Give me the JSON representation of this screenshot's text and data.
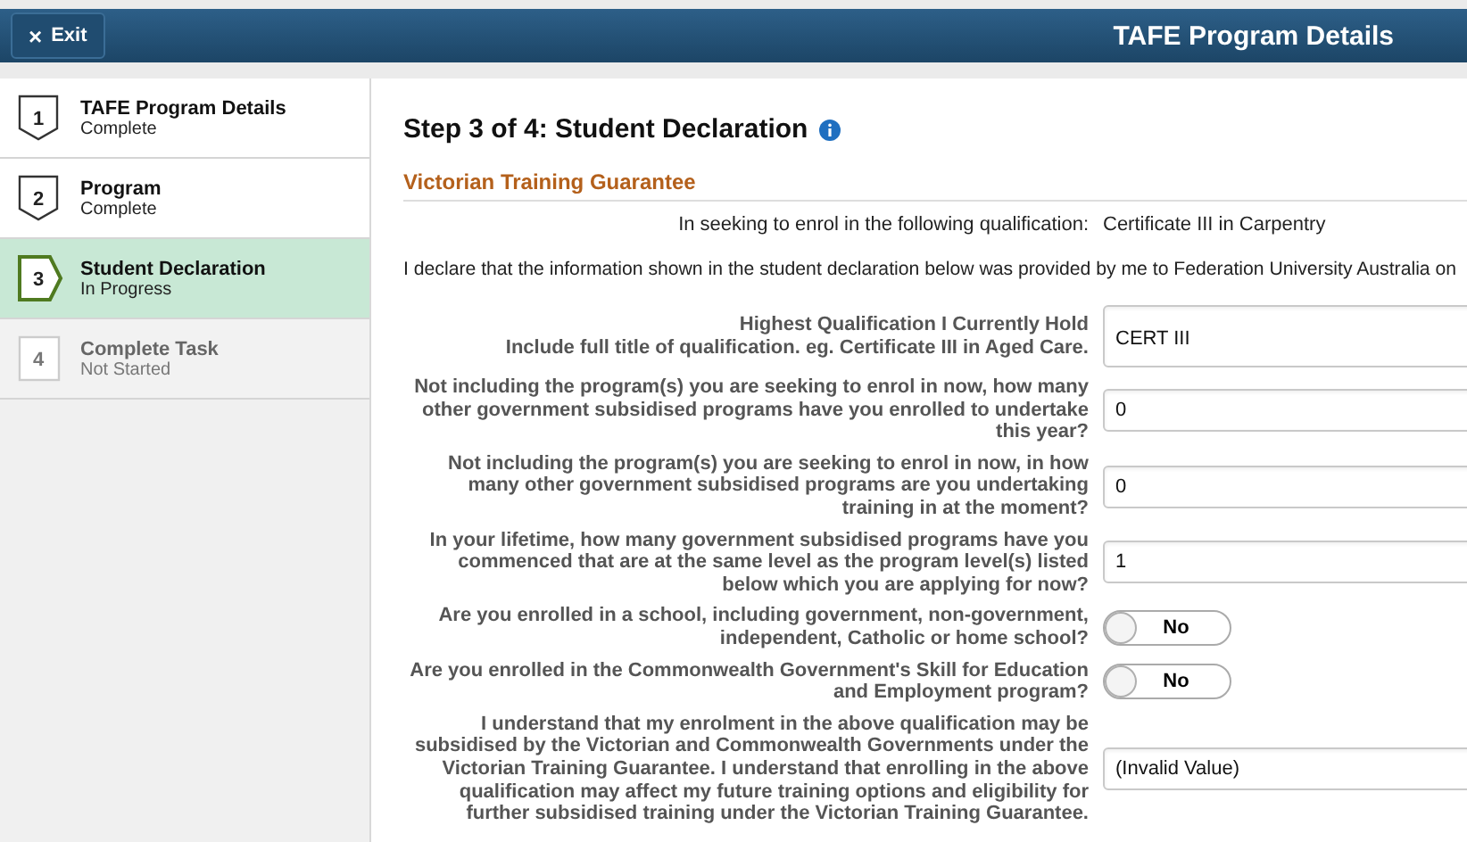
{
  "header": {
    "exit_label": "Exit",
    "exit_icon": "×",
    "title": "TAFE Program Details"
  },
  "steps": [
    {
      "number": "1",
      "name": "TAFE Program Details",
      "status": "Complete",
      "kind": "complete",
      "selected": false
    },
    {
      "number": "2",
      "name": "Program",
      "status": "Complete",
      "kind": "complete",
      "selected": false
    },
    {
      "number": "3",
      "name": "Student Declaration",
      "status": "In Progress",
      "kind": "current",
      "selected": true
    },
    {
      "number": "4",
      "name": "Complete Task",
      "status": "Not Started",
      "kind": "pending",
      "selected": false
    }
  ],
  "page": {
    "title": "Step 3 of 4: Student Declaration",
    "section": "Victorian Training Guarantee",
    "qualification_label": "In seeking to enrol in the following qualification:",
    "qualification_value": "Certificate III in Carpentry",
    "declaration": "I declare that the information shown in the student declaration below was provided by me to Federation University Australia on"
  },
  "questions": [
    {
      "kind": "text",
      "label": "Highest Qualification I Currently Hold",
      "hint": "Include full title of qualification. eg. Certificate III in Aged Care.",
      "value": "CERT III"
    },
    {
      "kind": "text",
      "label": "Not including the program(s) you are seeking to enrol in now, how many other government subsidised programs have you enrolled to undertake this year?",
      "value": "0"
    },
    {
      "kind": "text",
      "label": "Not including the program(s) you are seeking to enrol in now, in how many other government subsidised programs are you undertaking training in at the moment?",
      "value": "0"
    },
    {
      "kind": "text",
      "label": "In your lifetime, how many government subsidised programs have you commenced that are at the same level as the program level(s) listed below which you are applying for now?",
      "value": "1"
    },
    {
      "kind": "toggle",
      "label": "Are you enrolled in a school, including government, non-government, independent, Catholic or home school?",
      "value": "No",
      "on": false
    },
    {
      "kind": "toggle",
      "label": "Are you enrolled in the Commonwealth Government's Skill for Education and Employment program?",
      "value": "No",
      "on": false
    },
    {
      "kind": "text",
      "label": "I understand that my enrolment in the above qualification may be subsidised by the Victorian and Commonwealth Governments under the Victorian Training Guarantee. I understand that enrolling in the above qualification may affect my future training options and eligibility for further subsidised training under the Victorian Training Guarantee.",
      "value": "(Invalid Value)"
    }
  ]
}
